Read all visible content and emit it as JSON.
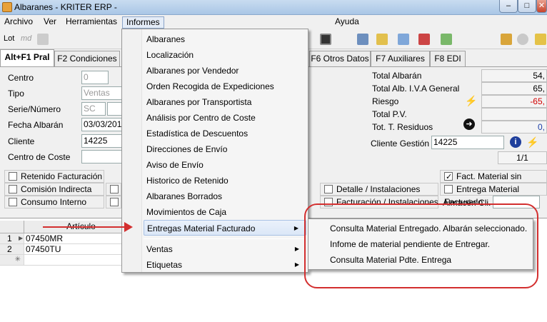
{
  "window": {
    "title": "Albaranes - KRITER ERP -",
    "minimize": "–",
    "maximize": "□",
    "close": "✕"
  },
  "menubar": [
    "Archivo",
    "Ver",
    "Herramientas",
    "Informes",
    "Ayuda"
  ],
  "toolbar": {
    "lot": "Lot",
    "md": "md"
  },
  "tabs": [
    "Alt+F1 Pral",
    "F2 Condiciones",
    "F6 Otros Datos",
    "F7 Auxiliares",
    "F8 EDI"
  ],
  "form": {
    "centro": {
      "label": "Centro",
      "value": "0"
    },
    "tipo": {
      "label": "Tipo",
      "value": "Ventas"
    },
    "serie": {
      "label": "Serie/Número",
      "value": "SC"
    },
    "fecha": {
      "label": "Fecha Albarán",
      "value": "03/03/201"
    },
    "cliente": {
      "label": "Cliente",
      "value": "14225"
    },
    "coste": {
      "label": "Centro de Coste"
    }
  },
  "totals": [
    {
      "label": "Total Albarán",
      "value": "54,"
    },
    {
      "label": "Total Alb. I.V.A General",
      "value": "65,"
    },
    {
      "label": "Riesgo",
      "value": "-65,"
    },
    {
      "label": "Total P.V.",
      "value": ""
    },
    {
      "label": "Tot. T. Residuos",
      "value": "0,"
    }
  ],
  "cliente_gestion": {
    "label": "Cliente Gestión",
    "value": "14225"
  },
  "pager": "1/1",
  "checks_left": [
    "Retenido Facturación",
    "Comisión Indirecta",
    "Consumo Interno"
  ],
  "checks_right": [
    {
      "label": "Fact. Material sin Entrega",
      "checked": true
    },
    {
      "label": "Entrega Material Facturado",
      "checked": false
    }
  ],
  "checks_mid": [
    "Detalle / Instalaciones",
    "Facturación / Instalaciones"
  ],
  "almacen_label": "Almacén Cli.",
  "grid": {
    "header": "Artículo",
    "rows": [
      {
        "num": "1",
        "code": "07450MR"
      },
      {
        "num": "2",
        "code": "07450TU"
      }
    ],
    "new_row": "✳"
  },
  "informes_menu": [
    "Albaranes",
    "Localización",
    "Albaranes por Vendedor",
    "Orden Recogida de Expediciones",
    "Albaranes por Transportista",
    "Análisis por Centro de Coste",
    "Estadística de Descuentos",
    "Direcciones de Envío",
    "Aviso de Envío",
    "Historico de Retenido",
    "Albaranes Borrados",
    "Movimientos de Caja",
    "Entregas Material Facturado",
    "Ventas",
    "Etiquetas"
  ],
  "submenu": [
    "Consulta Material Entregado. Albarán seleccionado.",
    "Infome de material pendiente de Entregar.",
    "Consulta Material Pdte. Entrega"
  ],
  "colors": {
    "annotation": "#d32f2f",
    "highlight": "#dbe7f7"
  }
}
